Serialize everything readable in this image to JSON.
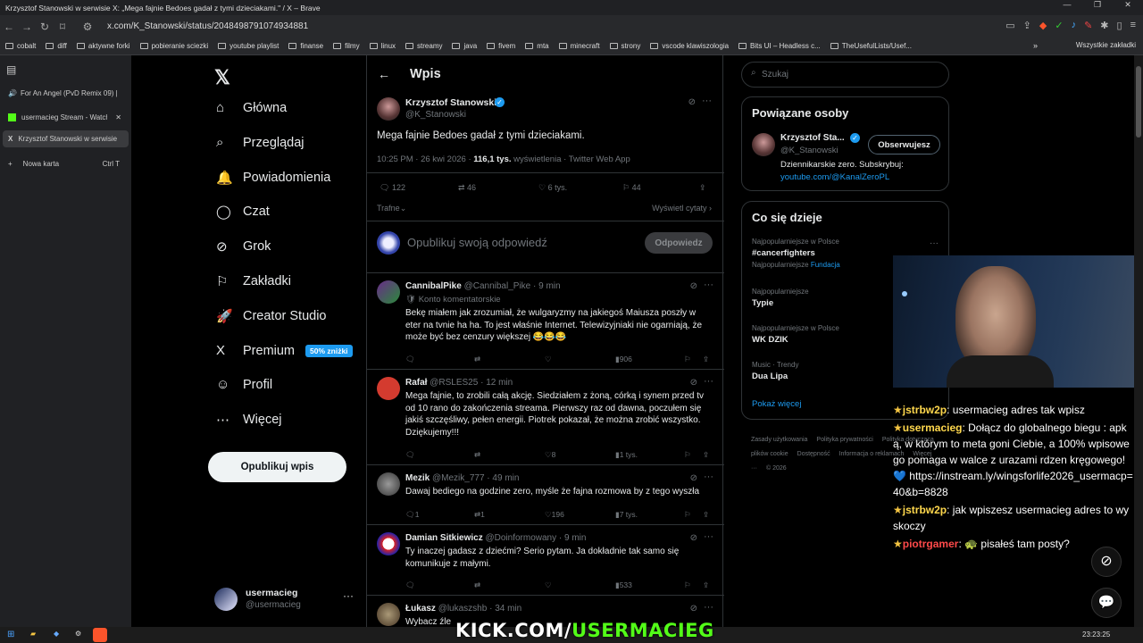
{
  "window": {
    "title": "Krzysztof Stanowski w serwisie X: „Mega fajnie Bedoes gadał z tymi dzieciakami.\" / X – Brave"
  },
  "browser": {
    "url": "x.com/K_Stanowski/status/2048498791074934881",
    "bookmarks": [
      "cobalt",
      "diff",
      "aktywne forki",
      "pobieranie sciezki",
      "youtube playlist",
      "finanse",
      "filmy",
      "linux",
      "streamy",
      "java",
      "fivem",
      "mta",
      "minecraft",
      "strony",
      "vscode klawiszologia",
      "Bits UI – Headless c...",
      "TheUsefulLists/Usef..."
    ],
    "bookmarks_all": "Wszystkie zakładki",
    "tabs": [
      "For An Angel (PvD Remix 09) |",
      "usermacieg Stream - Watch",
      "Krzysztof Stanowski w serwisie"
    ],
    "new_tab": "Nowa karta",
    "new_tab_shortcut": "Ctrl T"
  },
  "sidebar": {
    "items": [
      "Główna",
      "Przeglądaj",
      "Powiadomienia",
      "Czat",
      "Grok",
      "Zakładki",
      "Creator Studio",
      "Premium",
      "Profil",
      "Więcej"
    ],
    "premium_badge": "50% zniżki",
    "post_button": "Opublikuj wpis",
    "account_name": "usermacieg",
    "account_handle": "@usermacieg"
  },
  "post": {
    "header": "Wpis",
    "author": "Krzysztof Stanowski",
    "handle": "@K_Stanowski",
    "text": "Mega fajnie Bedoes gadał z tymi dzieciakami.",
    "meta_time": "10:25 PM · 26 kwi 2026 · ",
    "meta_views": "116,1 tys.",
    "meta_rest": " wyświetlenia · Twitter Web App",
    "replies": "122",
    "reposts": "46",
    "likes": "6 tys.",
    "bookmarks": "44",
    "sort": "Trafne",
    "quotes": "Wyświetl cytaty",
    "reply_placeholder": "Opublikuj swoją odpowiedź",
    "reply_button": "Odpowiedz"
  },
  "replies": [
    {
      "name": "CannibalPike",
      "handle": "@Cannibal_Pike · 9 min",
      "badge": "Konto komentatorskie",
      "text": "Bekę miałem jak zrozumiał, że wulgaryzmy na jakiegoś Maiusza poszły w eter na tvnie ha ha. To jest właśnie Internet. Telewizyjniaki nie ogarniają, że może być bez cenzury większej 😂😂😂",
      "replies": "",
      "reposts": "",
      "likes": "",
      "views": "906"
    },
    {
      "name": "Rafał",
      "handle": "@RSLES25 · 12 min",
      "badge": "",
      "text": "Mega fajnie, to zrobili całą akcję. Siedziałem z żoną, córką i synem przed tv od 10 rano do zakończenia streama. Pierwszy raz od dawna, poczułem się jakiś szczęśliwy, pełen energii. Piotrek pokazał, że można zrobić wszystko. Dziękujemy!!!",
      "replies": "",
      "reposts": "",
      "likes": "8",
      "views": "1 tys."
    },
    {
      "name": "Mezik",
      "handle": "@Mezik_777 · 49 min",
      "badge": "",
      "text": "Dawaj bediego na godzine zero, myśle że fajna rozmowa by z tego wyszła",
      "replies": "1",
      "reposts": "1",
      "likes": "196",
      "views": "7 tys."
    },
    {
      "name": "Damian Sitkiewicz",
      "handle": "@Doinformowany · 9 min",
      "badge": "",
      "text": "Ty inaczej gadasz z dziećmi? Serio pytam. Ja dokładnie tak samo się komunikuje z małymi.",
      "replies": "",
      "reposts": "",
      "likes": "",
      "views": "533"
    },
    {
      "name": "Łukasz",
      "handle": "@lukaszshb · 34 min",
      "badge": "",
      "text": "Wybacz źle",
      "replies": "",
      "reposts": "",
      "likes": "",
      "views": ""
    }
  ],
  "search": {
    "placeholder": "Szukaj"
  },
  "related": {
    "title": "Powiązane osoby",
    "name": "Krzysztof Sta...",
    "handle": "@K_Stanowski",
    "button": "Obserwujesz",
    "bio": "Dziennikarskie zero. Subskrybuj:",
    "link": "youtube.com/@KanalZeroPL"
  },
  "trends": {
    "title": "Co się dzieje",
    "items": [
      {
        "ctx": "Najpopularniejsze w Polsce",
        "name": "#cancerfighters",
        "extra": "Najpopularniejsze",
        "extra_link": "Fundacja"
      },
      {
        "ctx": "Najpopularniejsze",
        "name": "Typie",
        "extra": "",
        "extra_link": ""
      },
      {
        "ctx": "Najpopularniejsze w Polsce",
        "name": "WK DZIK",
        "extra": "",
        "extra_link": ""
      },
      {
        "ctx": "Music · Trendy",
        "name": "Dua Lipa",
        "extra": "",
        "extra_link": ""
      }
    ],
    "more": "Pokaż więcej"
  },
  "footer": [
    "Zasady użytkowania",
    "Polityka prywatności",
    "Polityka dotycząca plików cookie",
    "Dostępność",
    "Informacja o reklamach",
    "Więcej ···",
    "© 2026"
  ],
  "chat": [
    {
      "user": "jstrbw2p",
      "color": "#ffd84d",
      "text": ": usermacieg adres tak wpisz"
    },
    {
      "user": "usermacieg",
      "color": "#ffd84d",
      "text": ": Dołącz do globalnego biegu : apką, w którym to meta goni Ciebie, a 100% wpisowego pomaga w walce z urazami rdzen kręgowego! 💙 https://instream.ly/wingsforlife2026_usermacp=40&b=8828"
    },
    {
      "user": "jstrbw2p",
      "color": "#ffd84d",
      "text": ": jak wpiszesz usermacieg adres to wyskoczy"
    },
    {
      "user": "piotrgamer",
      "color": "#ff4a4a",
      "text": ": 🐢 pisałeś tam posty?"
    }
  ],
  "overlay": {
    "kick_prefix": "KICK.COM/",
    "kick_user": "USERMACIEG"
  },
  "clock": "23:23:25",
  "colors": {
    "accent": "#1d9bf0",
    "kick_green": "#53fc18",
    "x_bg": "#000000"
  }
}
